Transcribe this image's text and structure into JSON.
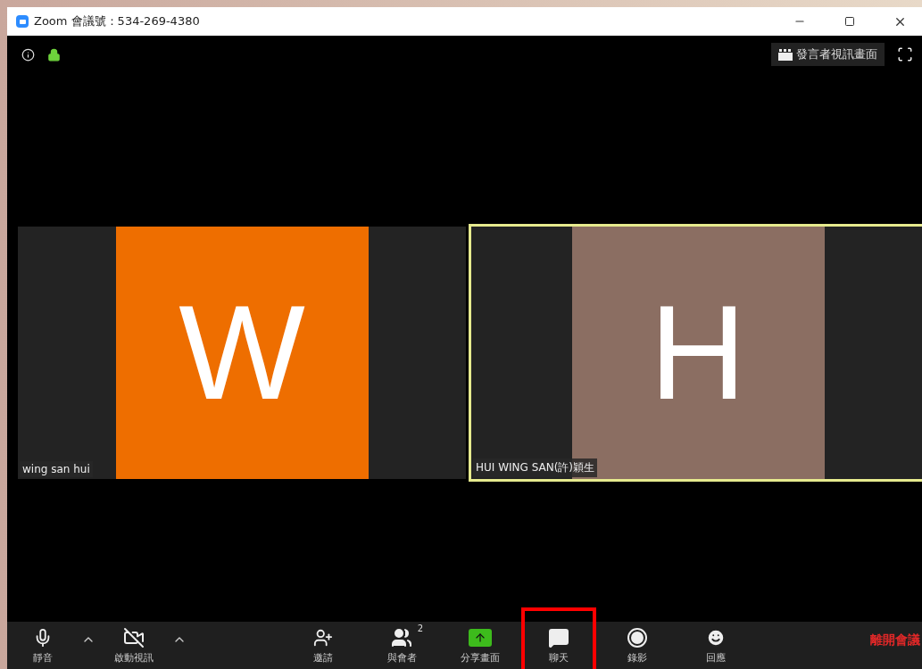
{
  "window": {
    "title": "Zoom 會議號：534-269-4380"
  },
  "view_switch": {
    "label": "發言者視訊畫面"
  },
  "tiles": [
    {
      "name": "wing san hui",
      "initial": "W",
      "color": "#ee6e00",
      "selected": false
    },
    {
      "name": "HUI WING SAN(許)穎生",
      "initial": "H",
      "color": "#8b6e62",
      "selected": true
    }
  ],
  "toolbar": [
    {
      "kind": "mute",
      "label": "靜音",
      "highlighted": false
    },
    {
      "kind": "caret"
    },
    {
      "kind": "video",
      "label": "啟動視訊",
      "highlighted": false
    },
    {
      "kind": "caret"
    },
    {
      "kind": "invite",
      "label": "邀請",
      "highlighted": false
    },
    {
      "kind": "participants",
      "label": "與會者",
      "count": "2",
      "highlighted": false
    },
    {
      "kind": "share",
      "label": "分享畫面",
      "highlighted": false
    },
    {
      "kind": "chat",
      "label": "聊天",
      "highlighted": true
    },
    {
      "kind": "record",
      "label": "錄影",
      "highlighted": false
    },
    {
      "kind": "reactions",
      "label": "回應",
      "highlighted": false
    }
  ],
  "leave": {
    "label": "離開會議"
  }
}
